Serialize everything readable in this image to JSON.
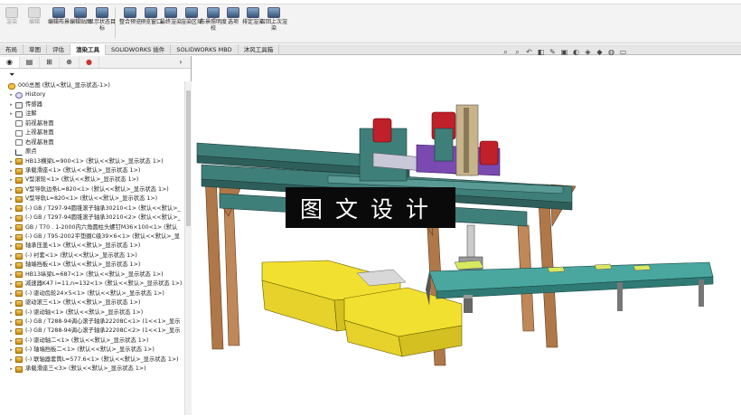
{
  "ribbon": {
    "buttons": [
      {
        "label": "渲染"
      },
      {
        "label": "编辑"
      },
      {
        "label": "编辑布景"
      },
      {
        "label": "编辑贴图"
      },
      {
        "label": "显示状态目标"
      },
      {
        "label": "整合预览"
      },
      {
        "label": "预览窗口"
      },
      {
        "label": "最终渲染"
      },
      {
        "label": "渲染区域"
      },
      {
        "label": "布景照明度校"
      },
      {
        "label": "选项"
      },
      {
        "label": "排定渲染"
      },
      {
        "label": "召回上次渲染"
      }
    ]
  },
  "command_tabs": [
    "布局",
    "草图",
    "评估",
    "渲染工具",
    "SOLIDWORKS 插件",
    "SOLIDWORKS MBD",
    "沐风工具箱"
  ],
  "active_tab_index": 3,
  "tree": {
    "root": "000总图 (默认<默认_显示状态-1>)",
    "items": [
      {
        "label": "History",
        "icon": "history-icon"
      },
      {
        "label": "传感器",
        "icon": "sensor-icon"
      },
      {
        "label": "注解",
        "icon": "annotation-icon"
      },
      {
        "label": "前视基准面",
        "icon": "plane-icon"
      },
      {
        "label": "上视基准面",
        "icon": "plane-icon"
      },
      {
        "label": "右视基准面",
        "icon": "plane-icon"
      },
      {
        "label": "原点",
        "icon": "origin-icon"
      },
      {
        "label": "HB13横梁L=900<1> (默认<<默认>_显示状态 1>)",
        "icon": "part-icon"
      },
      {
        "label": "承载滑座<1> (默认<<默认>_显示状态 1>)",
        "icon": "part-icon"
      },
      {
        "label": "V型滚轮<1> (默认<<默认>_显示状态 1>)",
        "icon": "part-icon"
      },
      {
        "label": "V型导轨边条L=820<1> (默认<<默认>_显示状态 1>)",
        "icon": "part-icon"
      },
      {
        "label": "V型导轨L=820<1> (默认<<默认>_显示状态 1>)",
        "icon": "part-icon"
      },
      {
        "label": "(-) GB / T297-94圆锥滚子轴承30210<1> (默认<<默认>_",
        "icon": "part-icon"
      },
      {
        "label": "(-) GB / T297-94圆锥滚子轴承30210<2> (默认<<默认>_",
        "icon": "part-icon"
      },
      {
        "label": "GB / T70 . 1-2000内六角圆柱头螺钉M36×100<1> (默认",
        "icon": "part-icon"
      },
      {
        "label": "(-) GB / T95-2002平垫圈C级39×6<1> (默认<<默认>_显",
        "icon": "part-icon"
      },
      {
        "label": "轴承压盖<1> (默认<<默认>_显示状态 1>)",
        "icon": "part-icon"
      },
      {
        "label": "(-) 衬套<1> (默认<<默认>_显示状态 1>)",
        "icon": "part-icon"
      },
      {
        "label": "轴端挡板<1> (默认<<默认>_显示状态 1>)",
        "icon": "part-icon"
      },
      {
        "label": "HB13纵梁L=687<1> (默认<<默认>_显示状态 1>)",
        "icon": "part-icon"
      },
      {
        "label": "减速器K47 i=11,n=132<1> (默认<<默认>_显示状态 1>)",
        "icon": "part-icon"
      },
      {
        "label": "(-) 驱动齿轮24×5<1> (默认<<默认>_显示状态 1>)",
        "icon": "part-icon"
      },
      {
        "label": "驱动滚三<1> (默认<<默认>_显示状态 1>)",
        "icon": "part-icon"
      },
      {
        "label": "(-) 驱动轴<1> (默认<<默认>_显示状态 1>)",
        "icon": "part-icon"
      },
      {
        "label": "(-) GB / T288-94调心滚子轴承22208C<1> (1<<1>_显示",
        "icon": "part-icon"
      },
      {
        "label": "(-) GB / T288-94调心滚子轴承22208C<2> (1<<1>_显示",
        "icon": "part-icon"
      },
      {
        "label": "(-) 驱动轴二<1> (默认<<默认>_显示状态 1>)",
        "icon": "part-icon"
      },
      {
        "label": "(-) 轴端挡板二<1> (默认<<默认>_显示状态 1>)",
        "icon": "part-icon"
      },
      {
        "label": "(-) 联轴器套筒L=577.6<1> (默认<<默认>_显示状态 1>)",
        "icon": "part-icon"
      },
      {
        "label": "承载滑座三<3> (默认<<默认>_显示状态 1>)",
        "icon": "part-icon"
      }
    ]
  },
  "overlay_text": "图文设计",
  "colors": {
    "frame_wood": "#b07848",
    "rail_teal": "#3f7f7a",
    "motor_red": "#c0202a",
    "bin_yellow": "#f2e030",
    "conveyor_teal": "#4aa7a0",
    "cover_black": "#0a0a0a"
  }
}
